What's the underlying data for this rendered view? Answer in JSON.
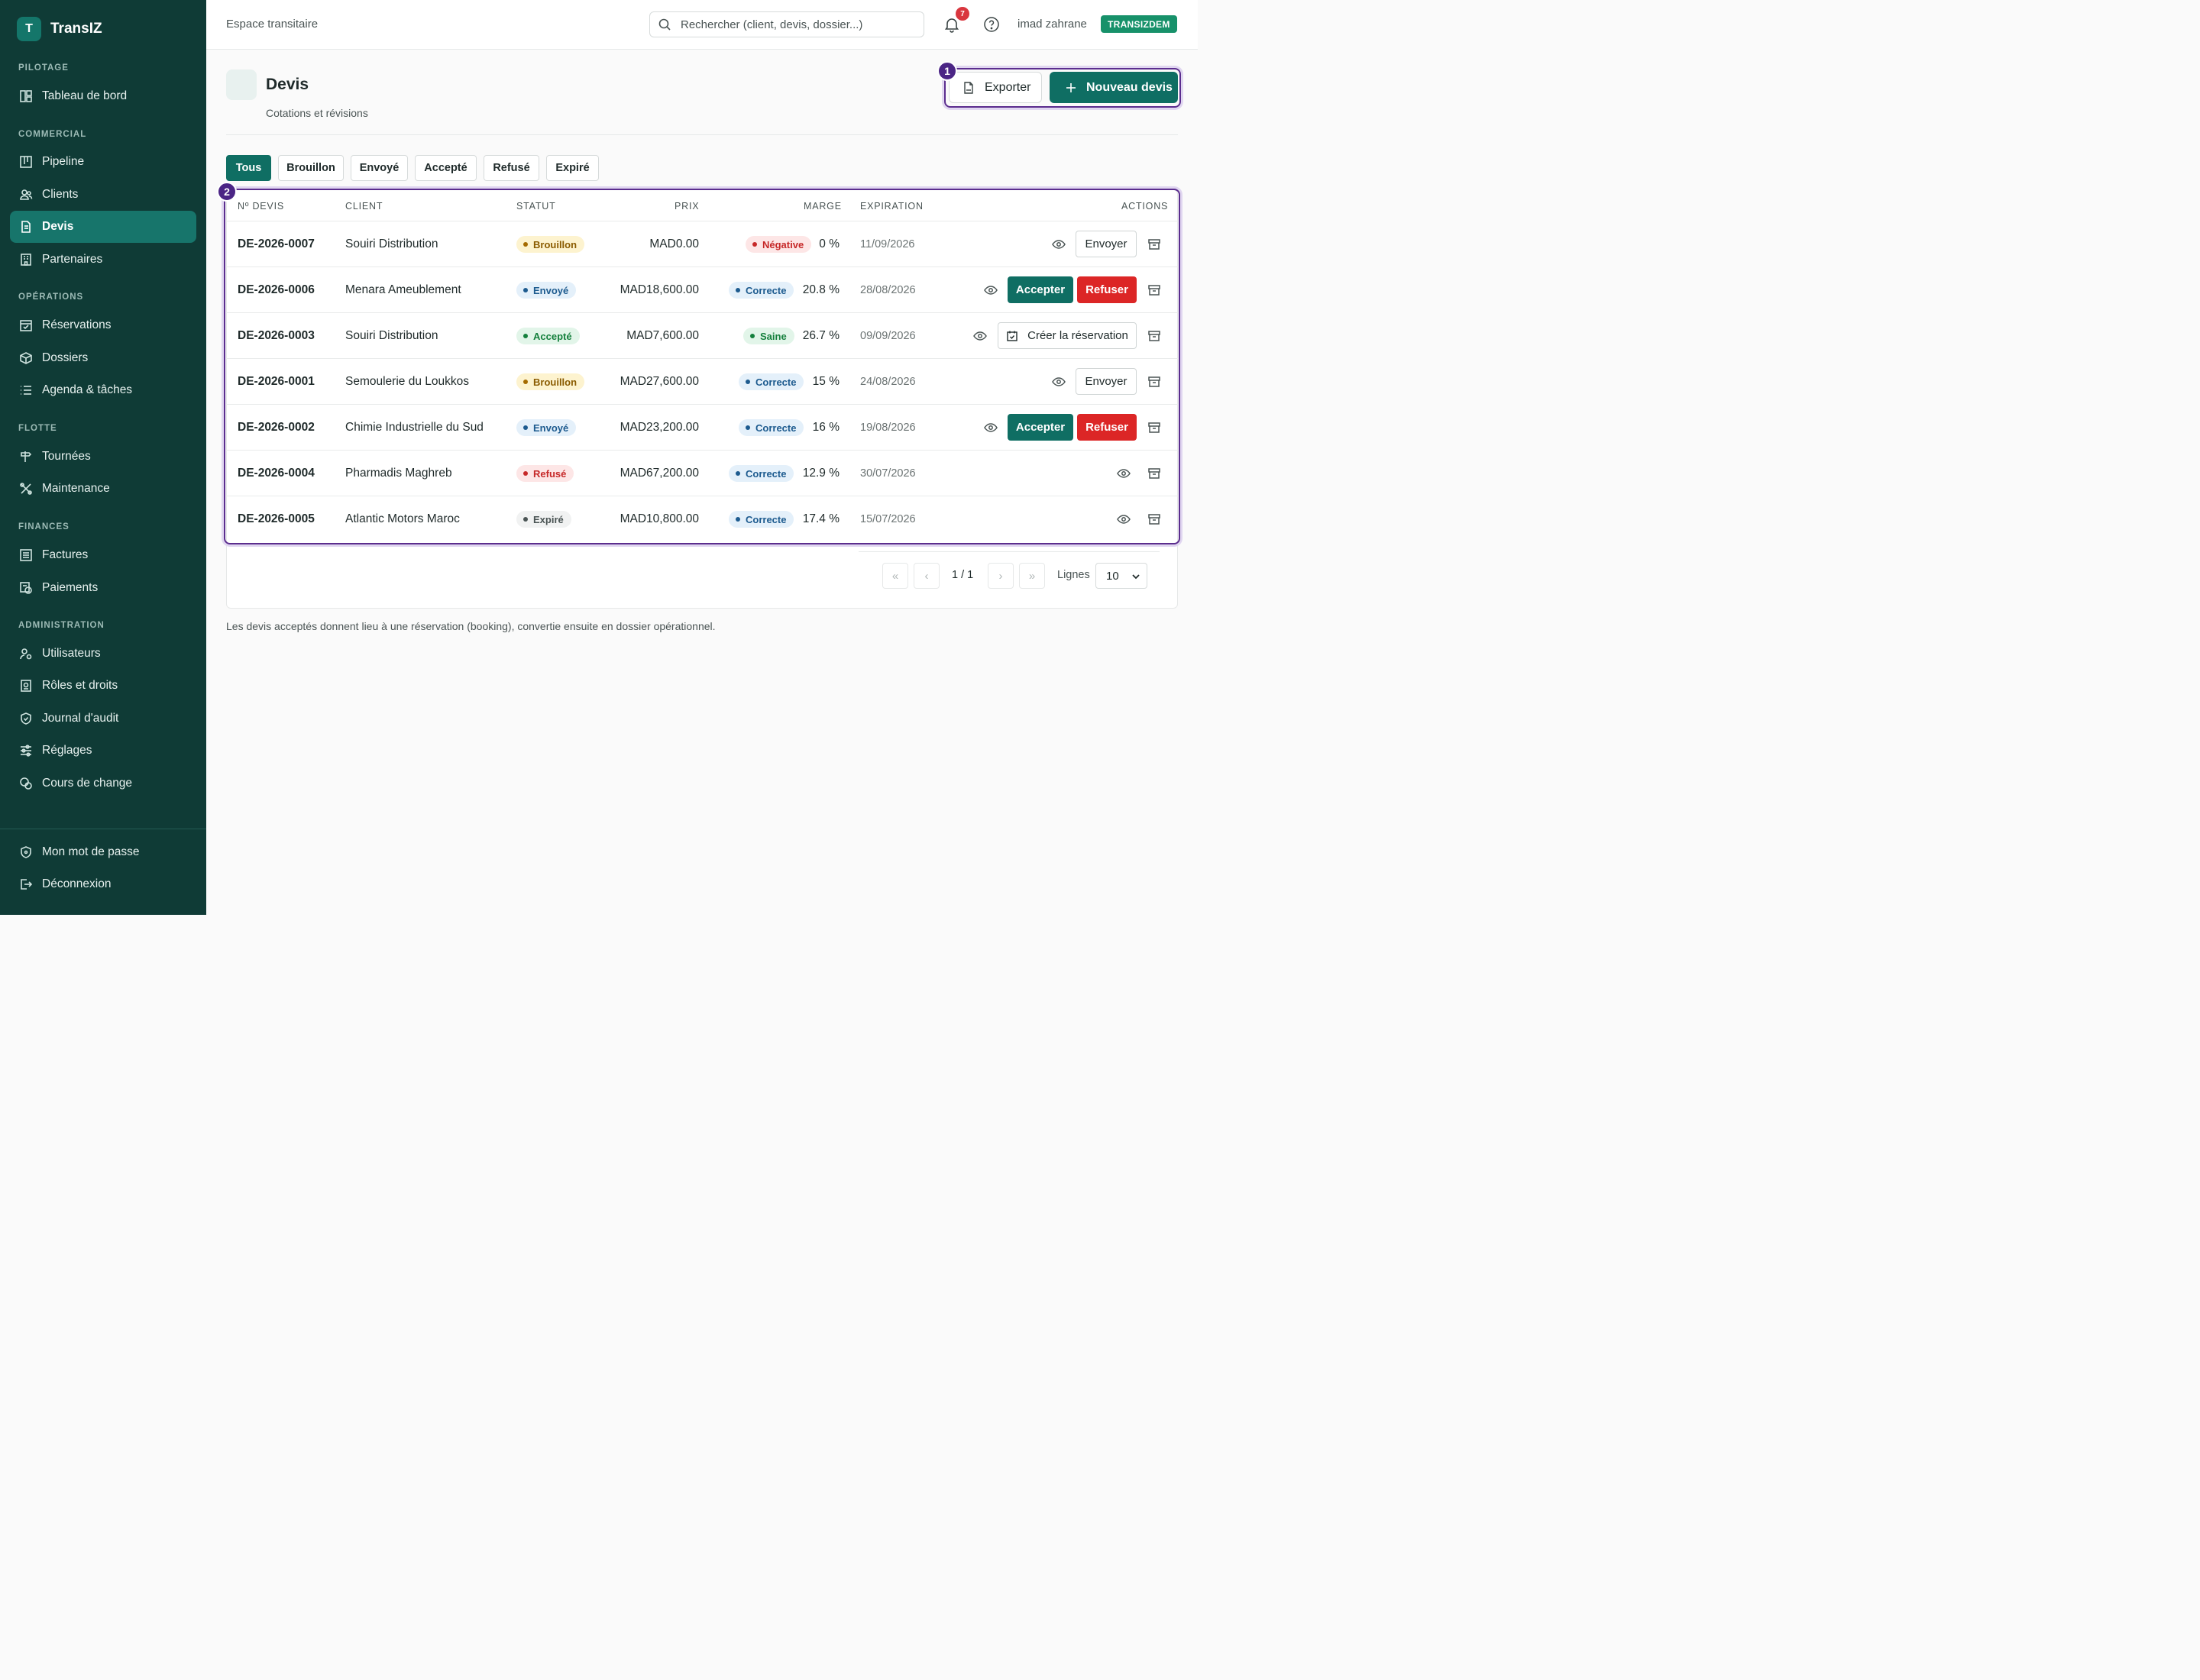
{
  "app": {
    "logo_letter": "T",
    "name": "TransIZ"
  },
  "sidebar": {
    "sections": [
      {
        "title": "PILOTAGE"
      },
      {
        "title": "COMMERCIAL"
      },
      {
        "title": "OPÉRATIONS"
      },
      {
        "title": "FLOTTE"
      },
      {
        "title": "FINANCES"
      },
      {
        "title": "ADMINISTRATION"
      }
    ],
    "items": [
      {
        "label": "Tableau de bord",
        "icon": "dashboard-icon"
      },
      {
        "label": "Pipeline",
        "icon": "kanban-icon"
      },
      {
        "label": "Clients",
        "icon": "users-icon"
      },
      {
        "label": "Devis",
        "icon": "document-icon",
        "active": true
      },
      {
        "label": "Partenaires",
        "icon": "building-icon"
      },
      {
        "label": "Réservations",
        "icon": "calendar-check-icon"
      },
      {
        "label": "Dossiers",
        "icon": "box-icon"
      },
      {
        "label": "Agenda & tâches",
        "icon": "list-icon"
      },
      {
        "label": "Tournées",
        "icon": "signpost-icon"
      },
      {
        "label": "Maintenance",
        "icon": "tools-icon"
      },
      {
        "label": "Factures",
        "icon": "receipt-icon"
      },
      {
        "label": "Paiements",
        "icon": "payments-icon"
      },
      {
        "label": "Utilisateurs",
        "icon": "user-cog-icon"
      },
      {
        "label": "Rôles et droits",
        "icon": "id-badge-icon"
      },
      {
        "label": "Journal d'audit",
        "icon": "shield-check-icon"
      },
      {
        "label": "Réglages",
        "icon": "sliders-icon"
      },
      {
        "label": "Cours de change",
        "icon": "coins-icon"
      }
    ],
    "bottom": [
      {
        "label": "Mon mot de passe",
        "icon": "shield-icon"
      },
      {
        "label": "Déconnexion",
        "icon": "logout-icon"
      }
    ]
  },
  "topbar": {
    "space_label": "Espace transitaire",
    "search_placeholder": "Rechercher (client, devis, dossier...)",
    "notif_count": "7",
    "username": "imad zahrane",
    "org_badge": "TRANSIZDEM"
  },
  "page": {
    "title": "Devis",
    "subtitle": "Cotations et révisions",
    "export_label": "Exporter",
    "new_label": "Nouveau devis",
    "marker_1": "1",
    "marker_2": "2"
  },
  "filters": [
    "Tous",
    "Brouillon",
    "Envoyé",
    "Accepté",
    "Refusé",
    "Expiré"
  ],
  "table": {
    "headers": {
      "id": "Nº DEVIS",
      "client": "CLIENT",
      "statut": "STATUT",
      "prix": "PRIX",
      "marge": "MARGE",
      "expiration": "EXPIRATION",
      "actions": "ACTIONS"
    },
    "rows": [
      {
        "id": "DE-2026-0007",
        "client": "Souiri Distribution",
        "statut": "Brouillon",
        "prix": "MAD0.00",
        "marge_label": "Négative",
        "marge": "0 %",
        "expiration": "11/09/2026",
        "action": "Envoyer"
      },
      {
        "id": "DE-2026-0006",
        "client": "Menara Ameublement",
        "statut": "Envoyé",
        "prix": "MAD18,600.00",
        "marge_label": "Correcte",
        "marge": "20.8 %",
        "expiration": "28/08/2026",
        "action": "Accepter",
        "action2": "Refuser"
      },
      {
        "id": "DE-2026-0003",
        "client": "Souiri Distribution",
        "statut": "Accepté",
        "prix": "MAD7,600.00",
        "marge_label": "Saine",
        "marge": "26.7 %",
        "expiration": "09/09/2026",
        "action": "Créer la réservation"
      },
      {
        "id": "DE-2026-0001",
        "client": "Semoulerie du Loukkos",
        "statut": "Brouillon",
        "prix": "MAD27,600.00",
        "marge_label": "Correcte",
        "marge": "15 %",
        "expiration": "24/08/2026",
        "action": "Envoyer"
      },
      {
        "id": "DE-2026-0002",
        "client": "Chimie Industrielle du Sud",
        "statut": "Envoyé",
        "prix": "MAD23,200.00",
        "marge_label": "Correcte",
        "marge": "16 %",
        "expiration": "19/08/2026",
        "action": "Accepter",
        "action2": "Refuser"
      },
      {
        "id": "DE-2026-0004",
        "client": "Pharmadis Maghreb",
        "statut": "Refusé",
        "prix": "MAD67,200.00",
        "marge_label": "Correcte",
        "marge": "12.9 %",
        "expiration": "30/07/2026"
      },
      {
        "id": "DE-2026-0005",
        "client": "Atlantic Motors Maroc",
        "statut": "Expiré",
        "prix": "MAD10,800.00",
        "marge_label": "Correcte",
        "marge": "17.4 %",
        "expiration": "15/07/2026"
      }
    ]
  },
  "pagination": {
    "first": "«",
    "prev": "‹",
    "page": "1 / 1",
    "next": "›",
    "last": "»",
    "lines_label": "Lignes",
    "lines_value": "10"
  },
  "footnote": "Les devis acceptés donnent lieu à une réservation (booking), convertie ensuite en dossier opérationnel.",
  "colors": {
    "sidebar": "#0f3b36",
    "accent": "#0f6e63",
    "danger": "#dc2626",
    "highlight": "#5b2d8e"
  }
}
